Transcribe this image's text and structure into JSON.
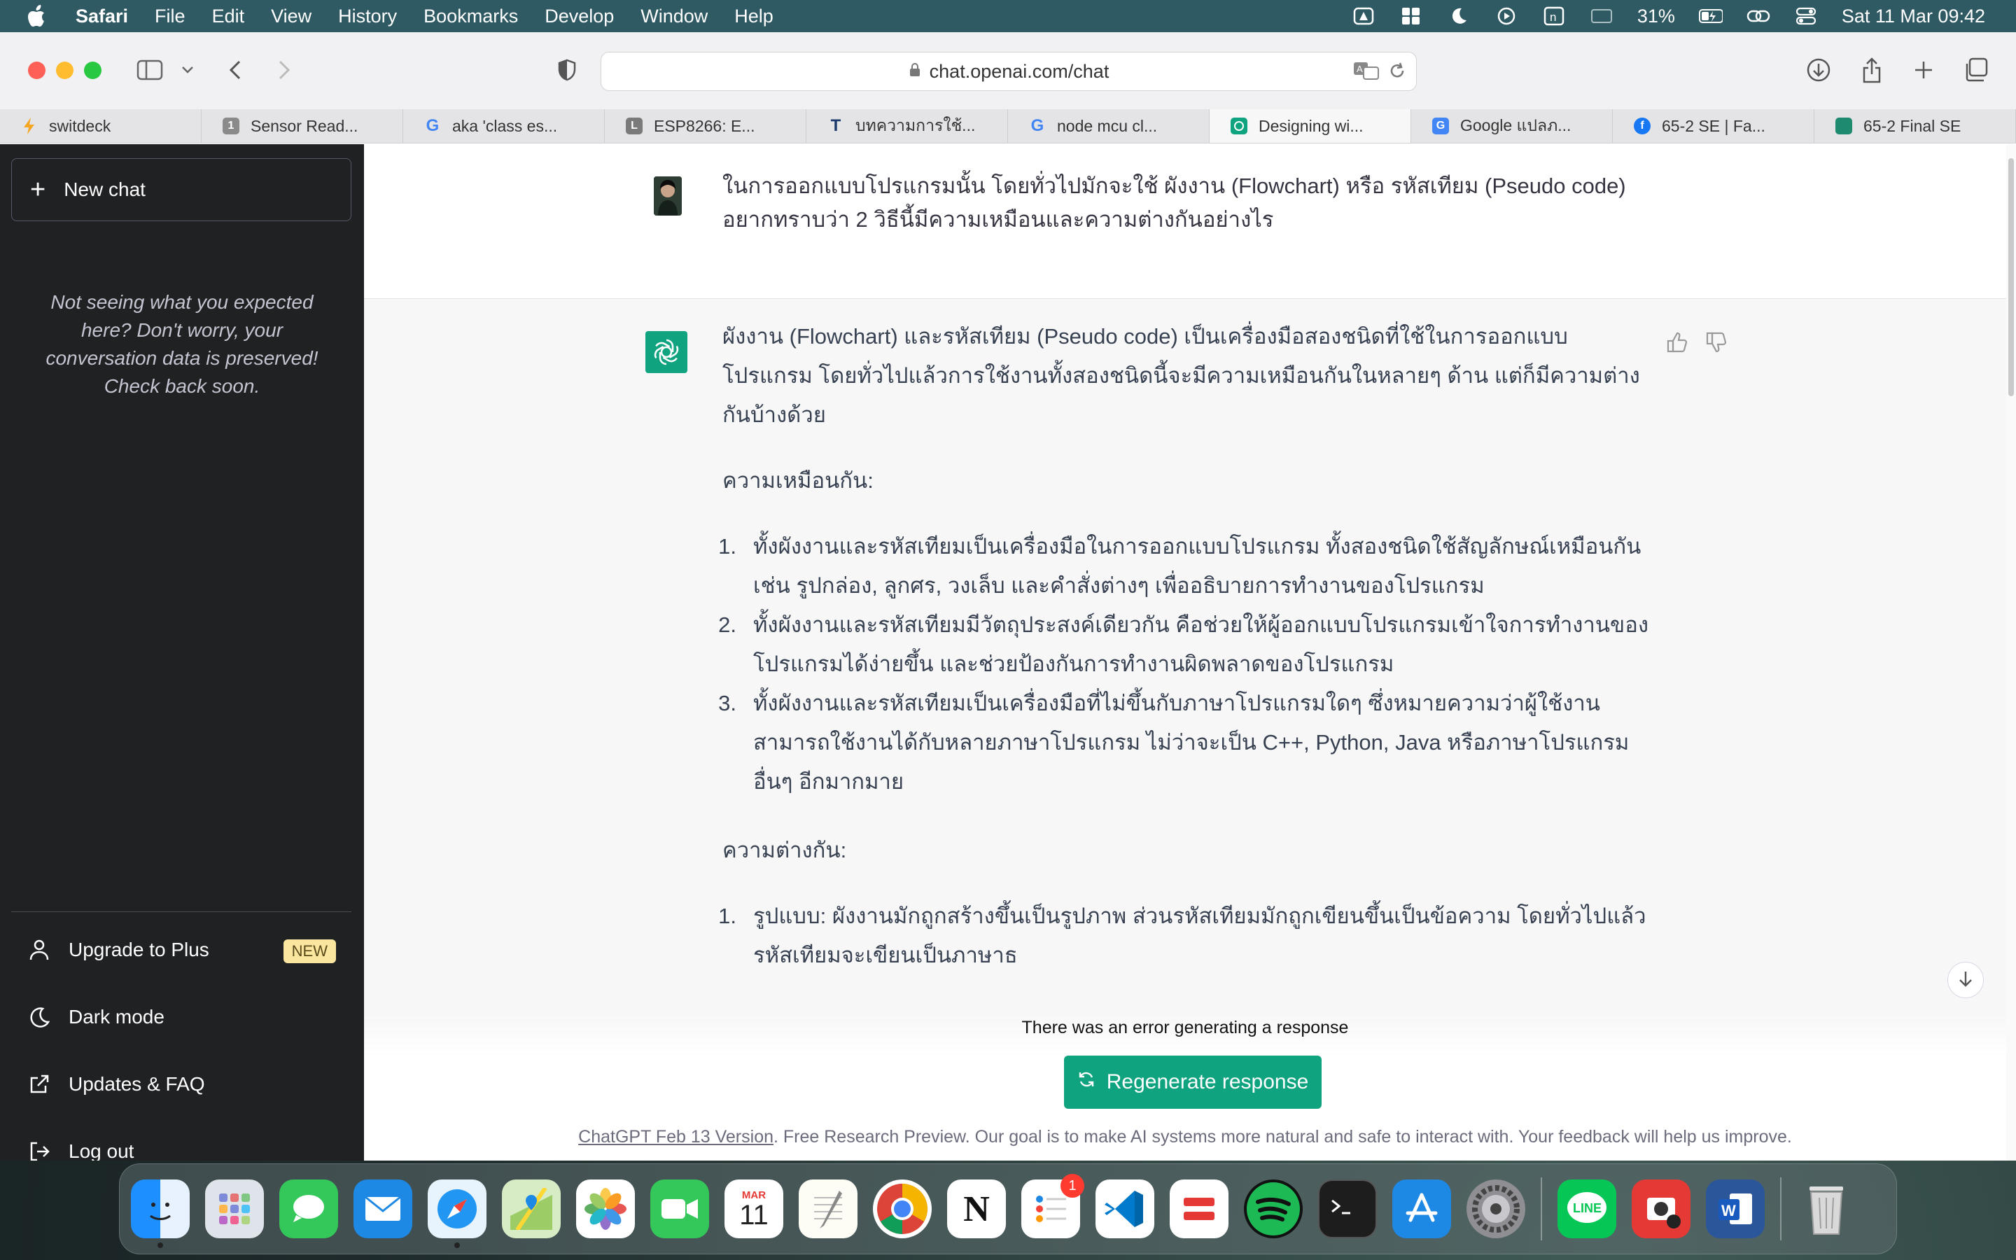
{
  "menubar": {
    "app_name": "Safari",
    "menus": [
      "File",
      "Edit",
      "View",
      "History",
      "Bookmarks",
      "Develop",
      "Window",
      "Help"
    ],
    "battery": "31%",
    "clock": "Sat 11 Mar  09:42"
  },
  "browser": {
    "url": "chat.openai.com/chat",
    "tabs": [
      {
        "label": "switdeck",
        "favicon_color": "#f5a623"
      },
      {
        "label": "Sensor Read...",
        "favicon_color": "#888888"
      },
      {
        "label": "aka 'class es...",
        "favicon_color": "#4285f4"
      },
      {
        "label": "ESP8266: E...",
        "favicon_color": "#777777"
      },
      {
        "label": "บทความการใช้...",
        "favicon_color": "#1a3a6b"
      },
      {
        "label": "node mcu cl...",
        "favicon_color": "#4285f4"
      },
      {
        "label": "Designing wi...",
        "favicon_color": "#10a37f"
      },
      {
        "label": "Google แปลภ...",
        "favicon_color": "#4285f4"
      },
      {
        "label": "65-2 SE | Fa...",
        "favicon_color": "#1877f2"
      },
      {
        "label": "65-2 Final SE",
        "favicon_color": "#1e8a6e"
      }
    ],
    "active_tab_index": 6
  },
  "sidebar": {
    "new_chat": "New chat",
    "note": "Not seeing what you expected here? Don't worry, your conversation data is preserved! Check back soon.",
    "upgrade": "Upgrade to Plus",
    "upgrade_badge": "NEW",
    "dark_mode": "Dark mode",
    "updates": "Updates & FAQ",
    "logout": "Log out"
  },
  "conversation": {
    "user_message_line1": "ในการออกแบบโปรแกรมนั้น โดยทั่วไปมักจะใช้ ผังงาน (Flowchart) หรือ รหัสเทียม (Pseudo code)",
    "user_message_line2": "อยากทราบว่า 2 วิธีนี้มีความเหมือนและความต่างกันอย่างไร",
    "intro_line1": "ผังงาน (Flowchart) และรหัสเทียม (Pseudo code) เป็นเครื่องมือสองชนิดที่ใช้ในการออกแบบ",
    "intro_line2": "โปรแกรม โดยทั่วไปแล้วการใช้งานทั้งสองชนิดนี้จะมีความเหมือนกันในหลายๆ ด้าน แต่ก็มีความต่าง",
    "intro_line3": "กันบ้างด้วย",
    "similar_heading": "ความเหมือนกัน:",
    "similar_items": [
      {
        "num": "1.",
        "line1": "ทั้งผังงานและรหัสเทียมเป็นเครื่องมือในการออกแบบโปรแกรม ทั้งสองชนิดใช้สัญลักษณ์เหมือนกัน",
        "line2": "เช่น รูปกล่อง, ลูกศร, วงเล็บ และคำสั่งต่างๆ เพื่ออธิบายการทำงานของโปรแกรม",
        "line3": ""
      },
      {
        "num": "2.",
        "line1": "ทั้งผังงานและรหัสเทียมมีวัตถุประสงค์เดียวกัน คือช่วยให้ผู้ออกแบบโปรแกรมเข้าใจการทำงานของ",
        "line2": "โปรแกรมได้ง่ายขึ้น และช่วยป้องกันการทำงานผิดพลาดของโปรแกรม",
        "line3": ""
      },
      {
        "num": "3.",
        "line1": "ทั้งผังงานและรหัสเทียมเป็นเครื่องมือที่ไม่ขึ้นกับภาษาโปรแกรมใดๆ ซึ่งหมายความว่าผู้ใช้งาน",
        "line2": "สามารถใช้งานได้กับหลายภาษาโปรแกรม ไม่ว่าจะเป็น C++, Python, Java หรือภาษาโปรแกรม",
        "line3": "อื่นๆ อีกมากมาย"
      }
    ],
    "different_heading": "ความต่างกัน:",
    "different_items": [
      {
        "num": "1.",
        "line1": "รูปแบบ: ผังงานมักถูกสร้างขึ้นเป็นรูปภาพ ส่วนรหัสเทียมมักถูกเขียนขึ้นเป็นข้อความ โดยทั่วไปแล้ว",
        "line2": "รหัสเทียมจะเขียนเป็นภาษาธ"
      }
    ],
    "error_text": "There was an error generating a response",
    "regenerate": "Regenerate response",
    "footer_link": "ChatGPT Feb 13 Version",
    "footer_text": ". Free Research Preview. Our goal is to make AI systems more natural and safe to interact with. Your feedback will help us improve."
  },
  "dock": {
    "calendar_month": "MAR",
    "calendar_day": "11",
    "reminders_badge": "1",
    "apps": [
      "Finder",
      "Launchpad",
      "Messages",
      "Mail",
      "Safari",
      "Maps",
      "Photos",
      "FaceTime",
      "Calendar",
      "TextEdit",
      "Chrome",
      "Notion",
      "Reminders",
      "VS Code",
      "Scrobbles",
      "Spotify",
      "Terminal",
      "App Store",
      "System Settings",
      "LINE",
      "Photo Booth",
      "Word",
      "Trash"
    ]
  },
  "colors": {
    "accent": "#10a37f",
    "sidebar_bg": "#202123",
    "menubar_bg": "#2f5a63"
  }
}
